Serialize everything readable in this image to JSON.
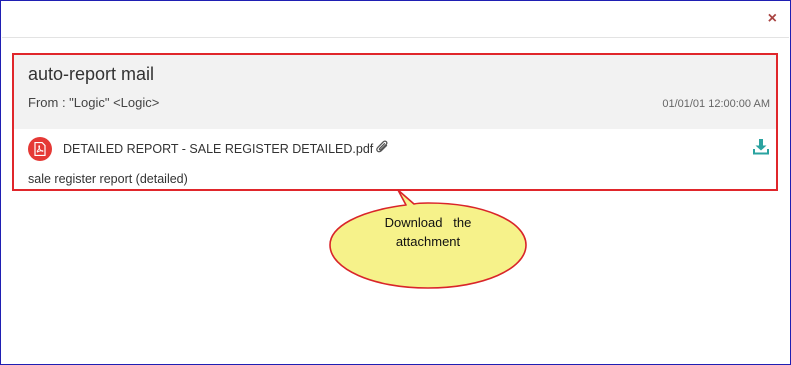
{
  "dialog": {
    "close_glyph": "×"
  },
  "mail": {
    "subject": "auto-report mail",
    "from": "From : \"Logic\" <Logic>",
    "date": "01/01/01 12:00:00 AM",
    "attachment": {
      "icon": "pdf-icon",
      "name": "DETAILED REPORT - SALE REGISTER DETAILED.pdf",
      "clip_icon": "paperclip-icon",
      "download_icon": "download-icon"
    },
    "description": "sale register report (detailed)"
  },
  "callout": {
    "line1": "Download   the",
    "line2": "attachment"
  },
  "colors": {
    "frame_border": "#1f1fb3",
    "highlight_border": "#e0262b",
    "header_bg": "#f2f2f2",
    "pdf_red": "#e53935",
    "download_teal": "#2aa3a0",
    "callout_fill": "#f6f28a",
    "callout_border": "#d9252a",
    "close_color": "#a94442"
  }
}
